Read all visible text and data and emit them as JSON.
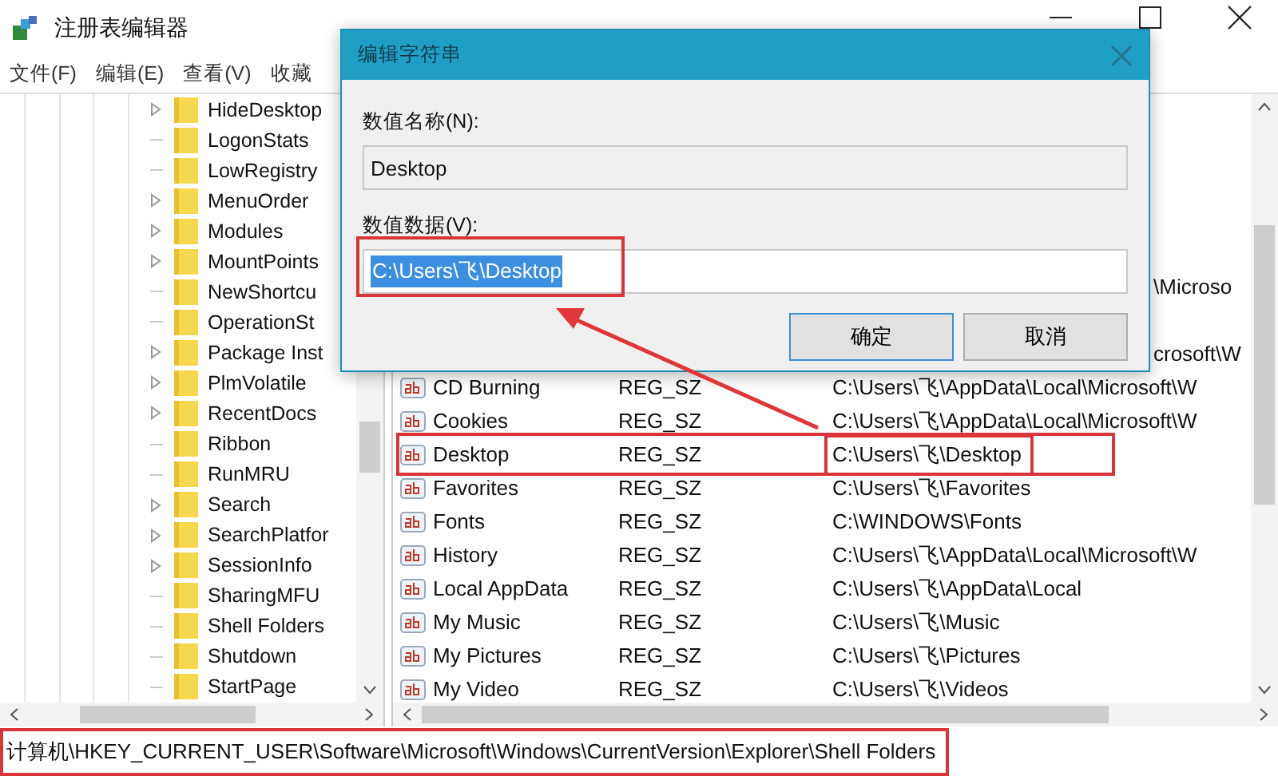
{
  "window": {
    "title": "注册表编辑器"
  },
  "menu": [
    {
      "label": "文件(F)"
    },
    {
      "label": "编辑(E)"
    },
    {
      "label": "查看(V)"
    },
    {
      "label": "收藏"
    }
  ],
  "tree": {
    "items": [
      {
        "label": "HideDesktop",
        "expandable": true
      },
      {
        "label": "LogonStats",
        "expandable": false
      },
      {
        "label": "LowRegistry",
        "expandable": false
      },
      {
        "label": "MenuOrder",
        "expandable": true
      },
      {
        "label": "Modules",
        "expandable": true
      },
      {
        "label": "MountPoints",
        "expandable": true
      },
      {
        "label": "NewShortcu",
        "expandable": false
      },
      {
        "label": "OperationSt",
        "expandable": false
      },
      {
        "label": "Package Inst",
        "expandable": true
      },
      {
        "label": "PlmVolatile",
        "expandable": true
      },
      {
        "label": "RecentDocs",
        "expandable": true
      },
      {
        "label": "Ribbon",
        "expandable": false
      },
      {
        "label": "RunMRU",
        "expandable": false
      },
      {
        "label": "Search",
        "expandable": true
      },
      {
        "label": "SearchPlatfor",
        "expandable": true
      },
      {
        "label": "SessionInfo",
        "expandable": true
      },
      {
        "label": "SharingMFU",
        "expandable": false
      },
      {
        "label": "Shell Folders",
        "expandable": false
      },
      {
        "label": "Shutdown",
        "expandable": false
      },
      {
        "label": "StartPage",
        "expandable": false
      }
    ]
  },
  "values": {
    "rows": [
      {
        "kind": "covered",
        "data": "\\Microso"
      },
      {
        "kind": "covered",
        "data": "crosoft\\W"
      },
      {
        "kind": "value",
        "name": "CD Burning",
        "type": "REG_SZ",
        "data": "C:\\Users\\飞\\AppData\\Local\\Microsoft\\W",
        "annotated": false
      },
      {
        "kind": "value",
        "name": "Cookies",
        "type": "REG_SZ",
        "data": "C:\\Users\\飞\\AppData\\Local\\Microsoft\\W",
        "annotated": false
      },
      {
        "kind": "value",
        "name": "Desktop",
        "type": "REG_SZ",
        "data": "C:\\Users\\飞\\Desktop",
        "annotated": true
      },
      {
        "kind": "value",
        "name": "Favorites",
        "type": "REG_SZ",
        "data": "C:\\Users\\飞\\Favorites",
        "annotated": false
      },
      {
        "kind": "value",
        "name": "Fonts",
        "type": "REG_SZ",
        "data": "C:\\WINDOWS\\Fonts",
        "annotated": false
      },
      {
        "kind": "value",
        "name": "History",
        "type": "REG_SZ",
        "data": "C:\\Users\\飞\\AppData\\Local\\Microsoft\\W",
        "annotated": false
      },
      {
        "kind": "value",
        "name": "Local AppData",
        "type": "REG_SZ",
        "data": "C:\\Users\\飞\\AppData\\Local",
        "annotated": false
      },
      {
        "kind": "value",
        "name": "My Music",
        "type": "REG_SZ",
        "data": "C:\\Users\\飞\\Music",
        "annotated": false
      },
      {
        "kind": "value",
        "name": "My Pictures",
        "type": "REG_SZ",
        "data": "C:\\Users\\飞\\Pictures",
        "annotated": false
      },
      {
        "kind": "value",
        "name": "My Video",
        "type": "REG_SZ",
        "data": "C:\\Users\\飞\\Videos",
        "annotated": false
      }
    ]
  },
  "status_bar": {
    "path": "计算机\\HKEY_CURRENT_USER\\Software\\Microsoft\\Windows\\CurrentVersion\\Explorer\\Shell Folders",
    "annotated": true
  },
  "dialog": {
    "title": "编辑字符串",
    "name_label": "数值名称(N):",
    "name_value": "Desktop",
    "data_label": "数值数据(V):",
    "data_value": "C:\\Users\\飞\\Desktop",
    "data_selected": true,
    "data_annotated": true,
    "buttons": [
      {
        "label": "确定",
        "default": true
      },
      {
        "label": "取消",
        "default": false
      }
    ]
  }
}
